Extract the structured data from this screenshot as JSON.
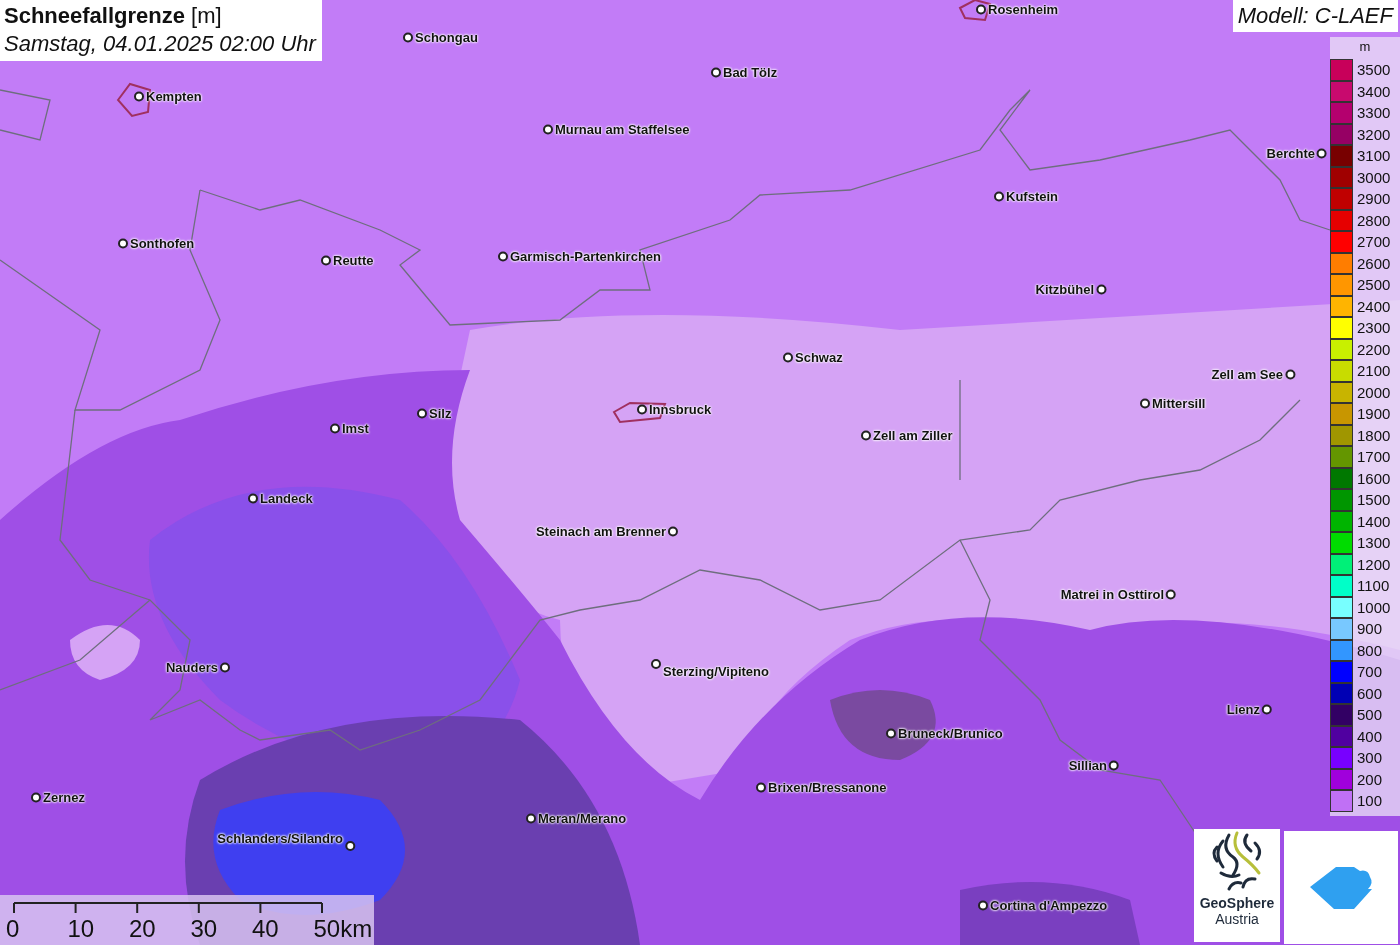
{
  "title": {
    "parameter": "Schneefallgrenze",
    "unit": "[m]",
    "datetime": "Samstag, 04.01.2025 02:00 Uhr"
  },
  "model": "Modell: C-LAEF",
  "towns": [
    {
      "name": "Rosenheim"
    },
    {
      "name": "Schongau"
    },
    {
      "name": "Bad Tölz"
    },
    {
      "name": "Kempten"
    },
    {
      "name": "Murnau am Staffelsee"
    },
    {
      "name": "Berchte"
    },
    {
      "name": "Kufstein"
    },
    {
      "name": "Sonthofen"
    },
    {
      "name": "Reutte"
    },
    {
      "name": "Garmisch-Partenkirchen"
    },
    {
      "name": "Kitzbühel"
    },
    {
      "name": "Schwaz"
    },
    {
      "name": "Zell am See"
    },
    {
      "name": "Mittersill"
    },
    {
      "name": "Silz"
    },
    {
      "name": "Innsbruck"
    },
    {
      "name": "Imst"
    },
    {
      "name": "Zell am Ziller"
    },
    {
      "name": "Landeck"
    },
    {
      "name": "Steinach am Brenner"
    },
    {
      "name": "Matrei in Osttirol"
    },
    {
      "name": "Nauders"
    },
    {
      "name": "Sterzing/Vipiteno"
    },
    {
      "name": "Lienz"
    },
    {
      "name": "Bruneck/Brunico"
    },
    {
      "name": "Sillian"
    },
    {
      "name": "Brixen/Bressanone"
    },
    {
      "name": "Zernez"
    },
    {
      "name": "Meran/Merano"
    },
    {
      "name": "Schlanders/Silandro"
    },
    {
      "name": "Cortina d'Ampezzo"
    }
  ],
  "legend": {
    "unit": "m",
    "items": [
      {
        "label": "3500",
        "color": "#c8005a"
      },
      {
        "label": "3400",
        "color": "#c80a6e"
      },
      {
        "label": "3300",
        "color": "#b4006e"
      },
      {
        "label": "3200",
        "color": "#960064"
      },
      {
        "label": "3100",
        "color": "#780000"
      },
      {
        "label": "3000",
        "color": "#a00000"
      },
      {
        "label": "2900",
        "color": "#c00000"
      },
      {
        "label": "2800",
        "color": "#e60000"
      },
      {
        "label": "2700",
        "color": "#ff0000"
      },
      {
        "label": "2600",
        "color": "#ff7d00"
      },
      {
        "label": "2500",
        "color": "#ff9600"
      },
      {
        "label": "2400",
        "color": "#ffb400"
      },
      {
        "label": "2300",
        "color": "#ffff00"
      },
      {
        "label": "2200",
        "color": "#c8f000"
      },
      {
        "label": "2100",
        "color": "#c8dc00"
      },
      {
        "label": "2000",
        "color": "#c8b400"
      },
      {
        "label": "1900",
        "color": "#c89600"
      },
      {
        "label": "1800",
        "color": "#a09600"
      },
      {
        "label": "1700",
        "color": "#649600"
      },
      {
        "label": "1600",
        "color": "#007800"
      },
      {
        "label": "1500",
        "color": "#009600"
      },
      {
        "label": "1400",
        "color": "#00b400"
      },
      {
        "label": "1300",
        "color": "#00dc00"
      },
      {
        "label": "1200",
        "color": "#00f078"
      },
      {
        "label": "1100",
        "color": "#00ffc8"
      },
      {
        "label": "1000",
        "color": "#78ffff"
      },
      {
        "label": "900",
        "color": "#78c8ff"
      },
      {
        "label": "800",
        "color": "#3296ff"
      },
      {
        "label": "700",
        "color": "#0000ff"
      },
      {
        "label": "600",
        "color": "#0000b4"
      },
      {
        "label": "500",
        "color": "#320064"
      },
      {
        "label": "400",
        "color": "#5000a0"
      },
      {
        "label": "300",
        "color": "#7800ff"
      },
      {
        "label": "200",
        "color": "#a000dc"
      },
      {
        "label": "100",
        "color": "#c070f5"
      }
    ]
  },
  "scale_bar": {
    "labels": [
      "0",
      "10",
      "20",
      "30",
      "40",
      "50km"
    ]
  },
  "logos": {
    "geosphere": {
      "line1": "GeoSphere",
      "line2": "Austria"
    }
  }
}
